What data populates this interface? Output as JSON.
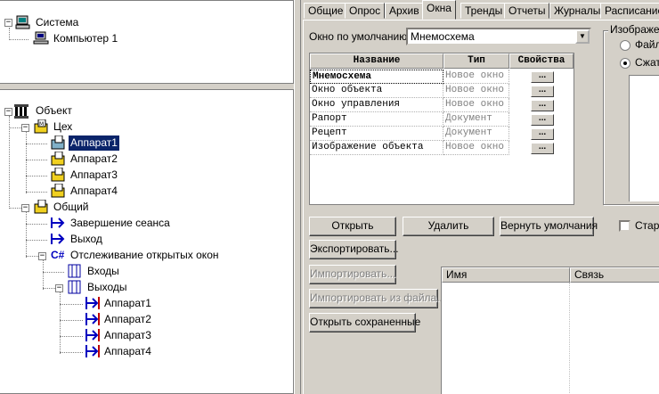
{
  "system_tree": {
    "root": "Система",
    "child": "Компьютер 1"
  },
  "object_tree": {
    "root": "Объект",
    "workshop": "Цех",
    "workshop_items": [
      "Аппарат1",
      "Аппарат2",
      "Аппарат3",
      "Аппарат4"
    ],
    "selected": "Аппарат1",
    "general": "Общий",
    "general_items": [
      "Завершение сеанса",
      "Выход"
    ],
    "tracking": "Отслеживание открытых окон",
    "inputs": "Входы",
    "outputs": "Выходы",
    "output_items": [
      "Аппарат1",
      "Аппарат2",
      "Аппарат3",
      "Аппарат4"
    ]
  },
  "tabs": [
    "Общие",
    "Опрос",
    "Архив",
    "Окна",
    "Тренды",
    "Отчеты",
    "Журналы",
    "Расписание"
  ],
  "active_tab": "Окна",
  "windows": {
    "default_label": "Окно по умолчанию :",
    "default_value": "Мнемосхема",
    "columns": [
      "Название",
      "Тип",
      "Свойства"
    ],
    "rows": [
      {
        "name": "Мнемосхема",
        "type": "Новое окно",
        "props": "..."
      },
      {
        "name": "Окно объекта",
        "type": "Новое окно",
        "props": "..."
      },
      {
        "name": "Окно управления",
        "type": "Новое окно",
        "props": "..."
      },
      {
        "name": "Рапорт",
        "type": "Документ",
        "props": "..."
      },
      {
        "name": "Рецепт",
        "type": "Документ",
        "props": "..."
      },
      {
        "name": "Изображение объекта",
        "type": "Новое окно",
        "props": "..."
      }
    ],
    "buttons": {
      "open": "Открыть",
      "delete": "Удалить",
      "restore": "Вернуть умолчания",
      "export": "Экспортировать...",
      "import": "Импортировать...",
      "import_file": "Импортировать из файла...",
      "open_saved": "Открыть сохраненные"
    },
    "image_group": "Изображен",
    "radio_file": "Файл",
    "radio_compressed": "Сжато",
    "start_check": "Старт",
    "link_columns": [
      "Имя",
      "Связь"
    ]
  }
}
